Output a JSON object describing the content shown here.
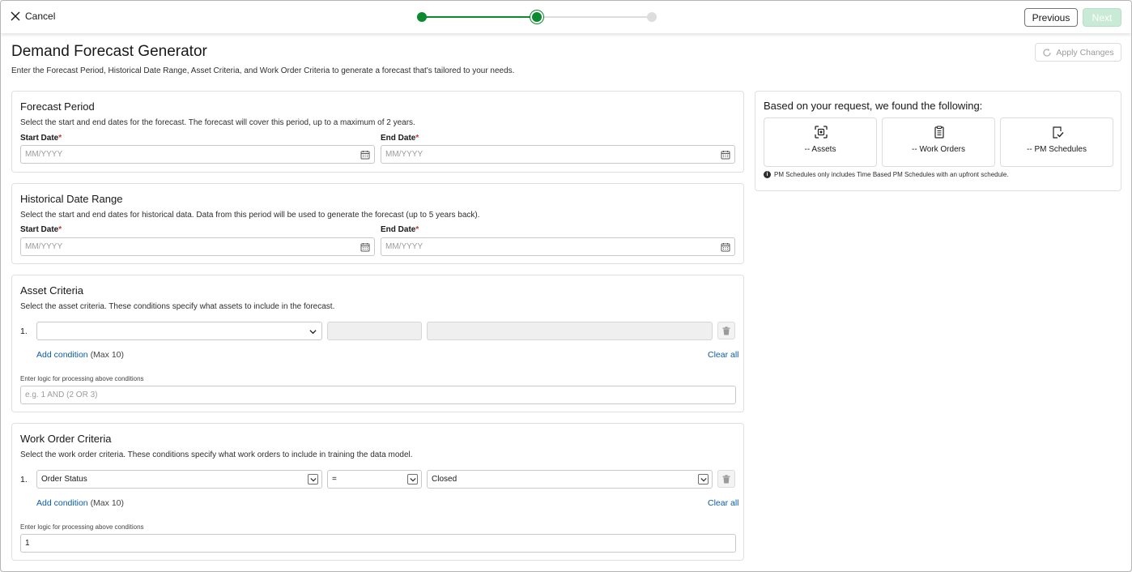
{
  "header": {
    "cancel_label": "Cancel",
    "previous_label": "Previous",
    "next_label": "Next"
  },
  "stepper": {
    "total_steps": 3,
    "current_step": 2,
    "active_color": "#0b8a30",
    "inactive_color": "#dddddd"
  },
  "page": {
    "title": "Demand Forecast Generator",
    "description": "Enter the Forecast Period, Historical Date Range, Asset Criteria, and Work Order Criteria to generate a forecast that's tailored to your needs.",
    "apply_changes_label": "Apply Changes"
  },
  "forecast_period": {
    "title": "Forecast Period",
    "description": "Select the start and end dates for the forecast. The forecast will cover this period, up to a maximum of 2 years.",
    "start_label": "Start Date",
    "end_label": "End Date",
    "start_placeholder": "MM/YYYY",
    "end_placeholder": "MM/YYYY"
  },
  "historical_range": {
    "title": "Historical Date Range",
    "description": "Select the start and end dates for historical data. Data from this period will be used to generate the forecast (up to 5 years back).",
    "start_label": "Start Date",
    "end_label": "End Date",
    "start_placeholder": "MM/YYYY",
    "end_placeholder": "MM/YYYY"
  },
  "required_marker": "*",
  "asset_criteria": {
    "title": "Asset Criteria",
    "description": "Select the asset criteria. These conditions specify what assets to include in the forecast.",
    "conditions": [
      {
        "number": "1.",
        "field": "",
        "operator": "",
        "value": ""
      }
    ],
    "add_condition_label": "Add condition",
    "add_condition_note": "(Max 10)",
    "clear_all_label": "Clear all",
    "logic_label": "Enter logic for processing above conditions",
    "logic_placeholder": "e.g. 1 AND (2 OR 3)",
    "logic_value": ""
  },
  "work_order_criteria": {
    "title": "Work Order Criteria",
    "description": "Select the work order criteria. These conditions specify what work orders to include in training the data model.",
    "conditions": [
      {
        "number": "1.",
        "field": "Order Status",
        "operator": "=",
        "value": "Closed"
      }
    ],
    "add_condition_label": "Add condition",
    "add_condition_note": "(Max 10)",
    "clear_all_label": "Clear all",
    "logic_label": "Enter logic for processing above conditions",
    "logic_value": "1"
  },
  "results": {
    "title": "Based on your request, we found the following:",
    "tiles": [
      {
        "label": "-- Assets",
        "icon": "asset-scan-icon"
      },
      {
        "label": "-- Work Orders",
        "icon": "clipboard-icon"
      },
      {
        "label": "-- PM Schedules",
        "icon": "checklist-icon"
      }
    ],
    "note": "PM Schedules only includes Time Based PM Schedules with an upfront schedule."
  }
}
